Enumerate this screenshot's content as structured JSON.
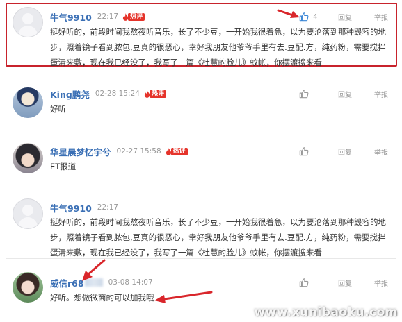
{
  "comments": [
    {
      "username": "牛气9910",
      "time": "22:17",
      "hot_label": "热评",
      "likes": "4",
      "reply_label": "回复",
      "report_label": "举报",
      "text": "挺好听的，前段时间我熬夜听音乐，长了不少豆，一开始我很着急，以为要沦落到那种毁容的地步，照着镜子看到脓包,豆真的很恶心，幸好我朋友他爷爷手里有去.豆配.方，纯药粉，需要搅拌蛋清来敷，现在我已经没了，我写了一篇《杜慧的脸儿》蚊帐，你摆渡搜来看"
    },
    {
      "username": "King鹏尧",
      "time": "02-28 15:24",
      "hot_label": "热评",
      "likes": "",
      "reply_label": "回复",
      "report_label": "举报",
      "text": "好听"
    },
    {
      "username": "华星晨梦忆宇兮",
      "time": "02-27 15:58",
      "hot_label": "热评",
      "likes": "",
      "reply_label": "回复",
      "report_label": "举报",
      "text": "ET报道"
    },
    {
      "username": "牛气9910",
      "time": "22:17",
      "likes": "",
      "reply_label": "回复",
      "report_label": "举报",
      "text": "挺好听的，前段时间我熬夜听音乐，长了不少豆，一开始我很着急，以为要沦落到那种毁容的地步，照着镜子看到脓包,豆真的很恶心，幸好我朋友他爷爷手里有去.豆配.方，纯药粉，需要搅拌蛋清来敷，现在我已经没了，我写了一篇《杜慧的脸儿》蚊帐，你摆渡搜来看"
    },
    {
      "username": "威信r68",
      "time": "03-08 14:07",
      "likes": "",
      "reply_label": "回复",
      "report_label": "举报",
      "text": "好听。想做微商的可以加我哦"
    }
  ],
  "watermark": "www.xunibaoku.com",
  "colors": {
    "username": "#3a6fb5",
    "hot_badge": "#e5332a",
    "highlight": "#c8232c",
    "like_highlight": "#3a86d6"
  },
  "icons": [
    "thumbs-up-icon",
    "flame-icon",
    "arrow-annotation"
  ]
}
